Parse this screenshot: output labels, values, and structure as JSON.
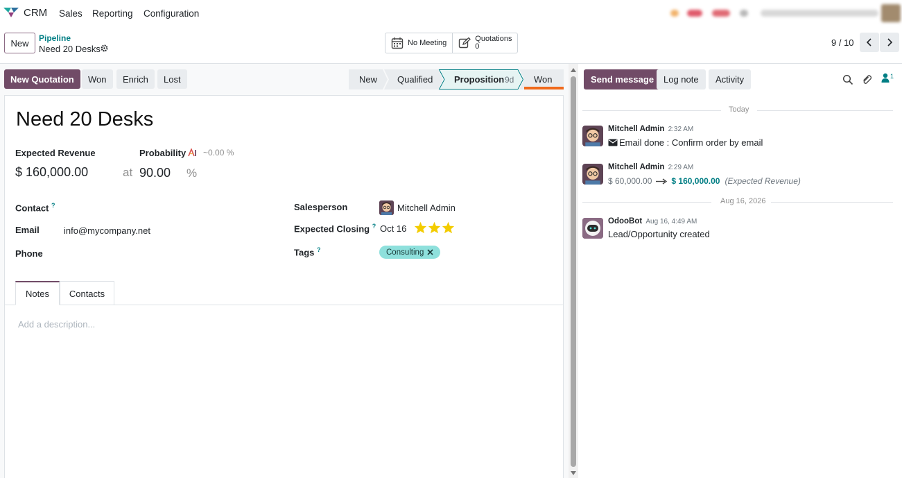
{
  "navbar": {
    "app_name": "CRM",
    "menu": [
      "Sales",
      "Reporting",
      "Configuration"
    ]
  },
  "control_panel": {
    "new_label": "New",
    "breadcrumb_parent": "Pipeline",
    "breadcrumb_current": "Need 20 Desks",
    "meeting_label": "No Meeting",
    "quotations_label": "Quotations",
    "quotations_count": "0",
    "pager": "9 / 10"
  },
  "statusbar": {
    "new_quotation": "New Quotation",
    "won": "Won",
    "enrich": "Enrich",
    "lost": "Lost",
    "stages": [
      {
        "label": "New"
      },
      {
        "label": "Qualified"
      },
      {
        "label": "Proposition",
        "badge": "9d"
      },
      {
        "label": "Won"
      }
    ]
  },
  "form": {
    "title": "Need 20 Desks",
    "expected_revenue_label": "Expected Revenue",
    "expected_revenue": "$ 160,000.00",
    "at": "at",
    "probability_label": "Probability",
    "ai_probability": "~0.00 %",
    "probability": "90.00",
    "percent": "%",
    "contact_label": "Contact",
    "email_label": "Email",
    "email": "info@mycompany.net",
    "phone_label": "Phone",
    "salesperson_label": "Salesperson",
    "salesperson": "Mitchell Admin",
    "expected_closing_label": "Expected Closing",
    "expected_closing": "Oct 16",
    "priority_stars": 3,
    "tags_label": "Tags",
    "tag": "Consulting",
    "help_mark": "?",
    "tabs": [
      "Notes",
      "Contacts"
    ],
    "notes_placeholder": "Add a description..."
  },
  "chatter": {
    "send_message": "Send message",
    "log_note": "Log note",
    "activity": "Activity",
    "followers_count": "1",
    "separators": [
      "Today",
      "Aug 16, 2026"
    ],
    "messages": [
      {
        "author": "Mitchell Admin",
        "time": "2:32 AM",
        "body": "Email done : Confirm order by email"
      },
      {
        "author": "Mitchell Admin",
        "time": "2:29 AM",
        "old_value": "$ 60,000.00",
        "new_value": "$ 160,000.00",
        "field": "(Expected Revenue)"
      },
      {
        "author": "OdooBot",
        "time": "Aug 16, 4:49 AM",
        "body": "Lead/Opportunity created"
      }
    ]
  },
  "colors": {
    "primary": "#714b67",
    "link": "#017e84",
    "tag_bg": "#8ee0dc",
    "star": "#f3cc00",
    "won_underline": "#f06a1c"
  }
}
